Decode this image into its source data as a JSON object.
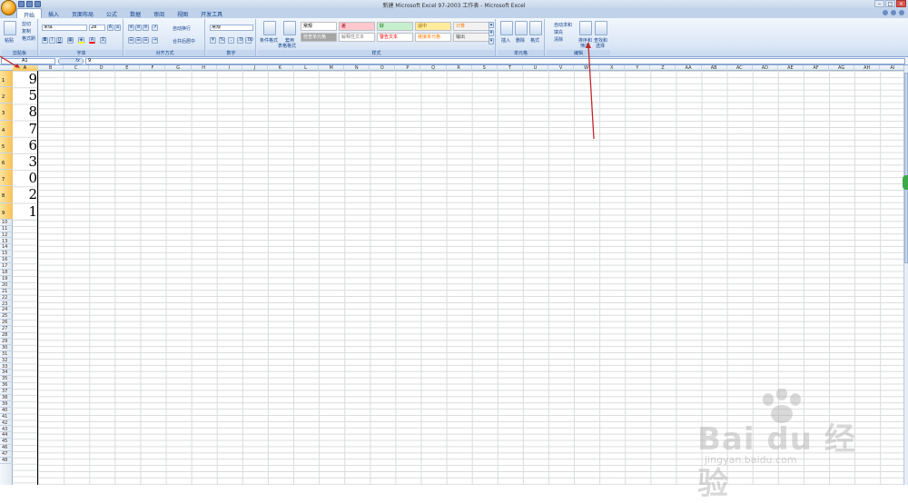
{
  "window": {
    "title": "新建 Microsoft Excel 97-2003 工作表 - Microsoft Excel"
  },
  "tabs": [
    {
      "label": "开始",
      "active": true
    },
    {
      "label": "插入"
    },
    {
      "label": "页面布局"
    },
    {
      "label": "公式"
    },
    {
      "label": "数据"
    },
    {
      "label": "审阅"
    },
    {
      "label": "视图"
    },
    {
      "label": "开发工具"
    }
  ],
  "ribbon": {
    "clipboard": {
      "label": "剪贴板",
      "paste": "粘贴",
      "cut": "剪切",
      "copy": "复制",
      "format_painter": "格式刷"
    },
    "font": {
      "label": "字体",
      "name": "宋体",
      "size": "28",
      "bold": "B",
      "italic": "I",
      "underline": "U"
    },
    "alignment": {
      "label": "对齐方式",
      "wrap": "自动换行",
      "merge": "合并后居中"
    },
    "number": {
      "label": "数字",
      "format": "常规",
      "percent": "%"
    },
    "styles": {
      "label": "样式",
      "conditional": "条件格式",
      "table": "套用",
      "table2": "表格格式",
      "cell_styles": [
        {
          "label": "常规",
          "bg": "#ffffff",
          "fg": "#000000"
        },
        {
          "label": "差",
          "bg": "#ffc7ce",
          "fg": "#9c0006"
        },
        {
          "label": "好",
          "bg": "#c6efce",
          "fg": "#006100"
        },
        {
          "label": "适中",
          "bg": "#ffeb9c",
          "fg": "#9c6500"
        },
        {
          "label": "计算",
          "bg": "#f2f2f2",
          "fg": "#fa7d00"
        },
        {
          "label": "检查单元格",
          "bg": "#a5a5a5",
          "fg": "#ffffff"
        },
        {
          "label": "解释性文本",
          "bg": "#ffffff",
          "fg": "#7f7f7f"
        },
        {
          "label": "警告文本",
          "bg": "#ffffff",
          "fg": "#ff0000"
        },
        {
          "label": "链接单元格",
          "bg": "#ffffff",
          "fg": "#fa7d00"
        },
        {
          "label": "输出",
          "bg": "#f2f2f2",
          "fg": "#3f3f3f"
        }
      ]
    },
    "cells": {
      "label": "单元格",
      "insert": "插入",
      "delete": "删除",
      "format": "格式"
    },
    "editing": {
      "label": "编辑",
      "autosum": "自动求和",
      "fill": "填充",
      "clear": "清除",
      "sort_filter": "排序和",
      "sort_filter2": "筛选",
      "find": "查找和",
      "find2": "选择"
    }
  },
  "formula_bar": {
    "name_box": "A1",
    "fx": "fx",
    "value": "9"
  },
  "columns": [
    "A",
    "B",
    "C",
    "D",
    "E",
    "F",
    "G",
    "H",
    "I",
    "J",
    "K",
    "L",
    "M",
    "N",
    "O",
    "P",
    "Q",
    "R",
    "S",
    "T",
    "U",
    "V",
    "W",
    "X",
    "Y",
    "Z",
    "AA",
    "AB",
    "AC",
    "AD",
    "AE",
    "AF",
    "AG",
    "AH",
    "AI"
  ],
  "column_a_values": [
    "9",
    "5",
    "8",
    "7",
    "6",
    "3",
    "0",
    "2",
    "1"
  ],
  "rows": [
    "1",
    "2",
    "3",
    "4",
    "5",
    "6",
    "7",
    "8",
    "9",
    "10",
    "11",
    "12",
    "13",
    "14",
    "15",
    "16",
    "17",
    "18",
    "19",
    "20",
    "21",
    "22",
    "23",
    "24",
    "25",
    "26",
    "27",
    "28",
    "29",
    "30",
    "31",
    "32",
    "33",
    "34",
    "35",
    "36",
    "37",
    "38",
    "39",
    "40",
    "41",
    "42",
    "43",
    "44",
    "45",
    "46",
    "47",
    "48"
  ],
  "watermark": {
    "brand": "Bai du 经验",
    "url": "jingyan.baidu.com"
  },
  "colors": {
    "accent": "#15428b",
    "annotation_arrow": "#c0282a",
    "selection": "#f7c157"
  }
}
